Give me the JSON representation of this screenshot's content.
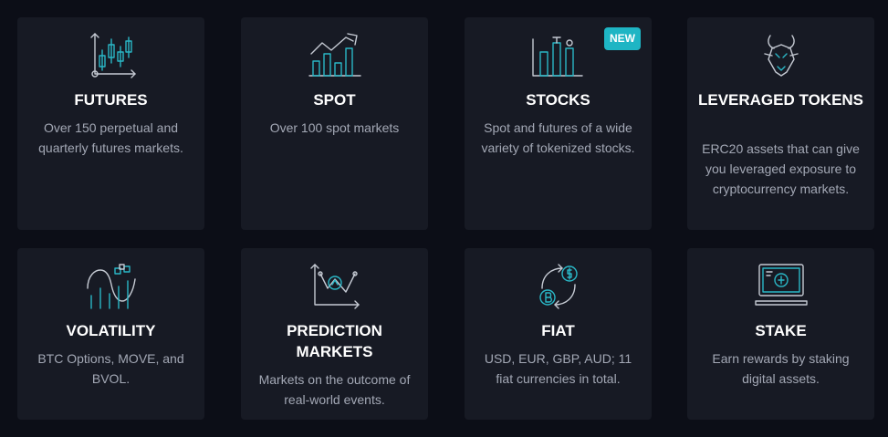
{
  "cards": [
    {
      "title": "FUTURES",
      "description": "Over 150 perpetual and quarterly futures markets.",
      "icon": "candlestick-chart-icon"
    },
    {
      "title": "SPOT",
      "description": "Over 100 spot markets",
      "icon": "rising-bar-chart-icon"
    },
    {
      "title": "STOCKS",
      "description": "Spot and futures of a wide variety of tokenized stocks.",
      "icon": "stock-buildings-icon",
      "badge": "NEW"
    },
    {
      "title": "LEVERAGED TOKENS",
      "description": "ERC20 assets that can give you leveraged exposure to cryptocurrency markets.",
      "icon": "bull-head-icon"
    },
    {
      "title": "VOLATILITY",
      "description": "BTC Options, MOVE, and BVOL.",
      "icon": "volatility-curve-icon"
    },
    {
      "title": "PREDICTION MARKETS",
      "description": "Markets on the outcome of real-world events.",
      "icon": "prediction-chart-icon"
    },
    {
      "title": "FIAT",
      "description": "USD, EUR, GBP, AUD; 11 fiat currencies in total.",
      "icon": "currency-exchange-icon"
    },
    {
      "title": "STAKE",
      "description": "Earn rewards by staking digital assets.",
      "icon": "staking-monitor-icon"
    }
  ]
}
